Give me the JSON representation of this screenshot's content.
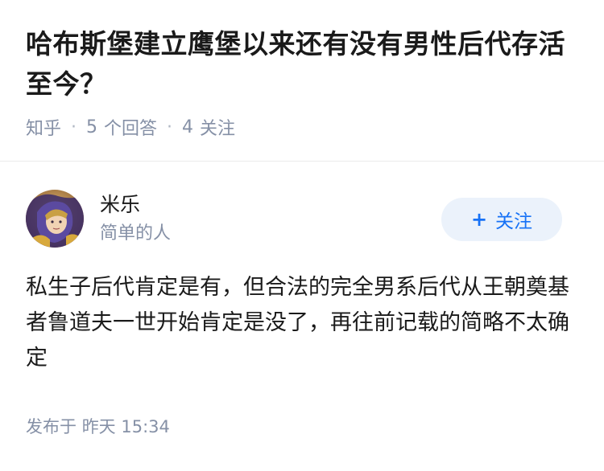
{
  "question": {
    "title": "哈布斯堡建立鹰堡以来还有没有男性后代存活至今？",
    "source": "知乎",
    "answer_count": "5",
    "answer_label": "个回答",
    "follow_count": "4",
    "follow_label": "关注"
  },
  "author": {
    "name": "米乐",
    "bio": "简单的人",
    "avatar_icon": "avatar-image",
    "follow_button_label": "关注"
  },
  "answer": {
    "content": "私生子后代肯定是有，但合法的完全男系后代从王朝奠基者鲁道夫一世开始肯定是没了，再往前记载的简略不太确定",
    "published_label": "发布于",
    "published_time": "昨天 15:34"
  },
  "colors": {
    "title": "#1a1a1a",
    "meta": "#8590a6",
    "follow_bg": "#ebf2fb",
    "follow_text": "#1772f6"
  }
}
